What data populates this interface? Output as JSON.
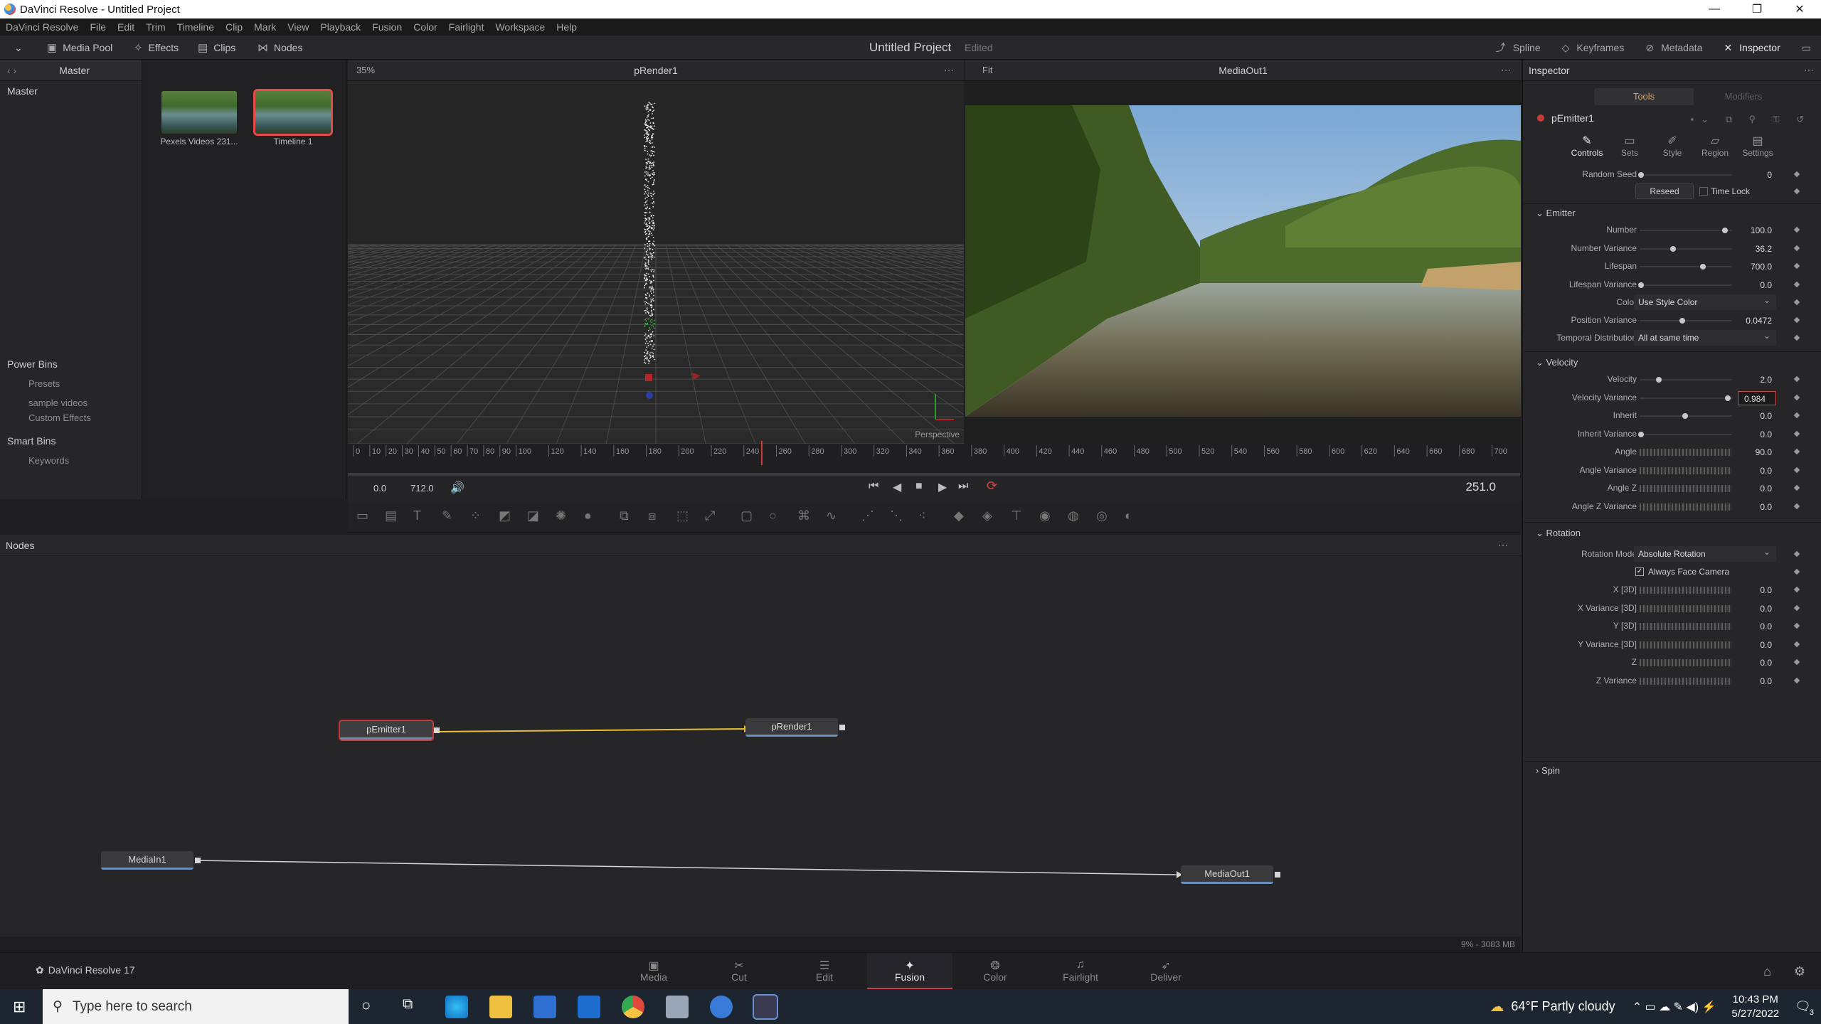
{
  "window": {
    "title": "DaVinci Resolve - Untitled Project",
    "minimize": "—",
    "maximize": "❐",
    "close": "✕"
  },
  "menu": [
    "DaVinci Resolve",
    "File",
    "Edit",
    "Trim",
    "Timeline",
    "Clip",
    "Mark",
    "View",
    "Playback",
    "Fusion",
    "Color",
    "Fairlight",
    "Workspace",
    "Help"
  ],
  "toolbar": {
    "media_pool": "Media Pool",
    "effects": "Effects",
    "clips": "Clips",
    "nodes": "Nodes",
    "project_title": "Untitled Project",
    "project_status": "Edited",
    "spline": "Spline",
    "keyframes": "Keyframes",
    "metadata": "Metadata",
    "inspector": "Inspector"
  },
  "bins": {
    "current": "Master",
    "master": "Master",
    "power_bins": "Power Bins",
    "power_items": [
      "Presets",
      "sample videos",
      "Custom Effects"
    ],
    "smart_bins": "Smart Bins",
    "smart_items": [
      "Keywords"
    ]
  },
  "media": [
    {
      "label": "Pexels Videos 231..."
    },
    {
      "label": "Timeline 1"
    }
  ],
  "viewer_left": {
    "zoom": "35%",
    "name": "pRender1",
    "mode": "Perspective"
  },
  "viewer_right": {
    "zoom": "Fit",
    "name": "MediaOut1"
  },
  "ruler": [
    "0",
    "10",
    "20",
    "30",
    "40",
    "50",
    "60",
    "70",
    "80",
    "90",
    "100",
    "120",
    "140",
    "160",
    "180",
    "200",
    "220",
    "240",
    "260",
    "280",
    "300",
    "320",
    "340",
    "360",
    "380",
    "400",
    "420",
    "440",
    "460",
    "480",
    "500",
    "520",
    "540",
    "560",
    "580",
    "600",
    "620",
    "640",
    "660",
    "680",
    "700"
  ],
  "transport": {
    "start": "0.0",
    "end": "712.0",
    "current": "251.0"
  },
  "nodes_panel": {
    "title": "Nodes",
    "nodes": [
      "pEmitter1",
      "pRender1",
      "MediaIn1",
      "MediaOut1"
    ]
  },
  "status": {
    "memory": "9% - 3083 MB"
  },
  "inspector": {
    "title": "Inspector",
    "tab_tools": "Tools",
    "tab_modifiers": "Modifiers",
    "node_name": "pEmitter1",
    "subtabs": [
      "Controls",
      "Sets",
      "Style",
      "Region",
      "Settings"
    ],
    "random_seed": {
      "label": "Random Seed",
      "value": "0"
    },
    "reseed": "Reseed",
    "time_lock": "Time Lock",
    "emitter_section": "Emitter",
    "emitter": [
      {
        "label": "Number",
        "value": "100.0",
        "level": 0.95
      },
      {
        "label": "Number Variance",
        "value": "36.2",
        "level": 0.36
      },
      {
        "label": "Lifespan",
        "value": "700.0",
        "level": 0.7
      },
      {
        "label": "Lifespan Variance",
        "value": "0.0",
        "level": 0.0
      }
    ],
    "color": {
      "label": "Color",
      "value": "Use Style Color"
    },
    "position_variance": {
      "label": "Position Variance",
      "value": "0.0472",
      "level": 0.47
    },
    "temporal": {
      "label": "Temporal Distribution",
      "value": "All at same time"
    },
    "velocity_section": "Velocity",
    "velocity": [
      {
        "label": "Velocity",
        "value": "2.0",
        "level": 0.2
      },
      {
        "label": "Velocity Variance",
        "value": "0.984",
        "level": 0.98
      },
      {
        "label": "Inherit",
        "value": "0.0",
        "level": 0.5
      },
      {
        "label": "Inherit Variance",
        "value": "0.0",
        "level": 0.0
      },
      {
        "label": "Angle",
        "value": "90.0"
      },
      {
        "label": "Angle Variance",
        "value": "0.0"
      },
      {
        "label": "Angle Z",
        "value": "0.0"
      },
      {
        "label": "Angle Z Variance",
        "value": "0.0"
      }
    ],
    "rotation_section": "Rotation",
    "rotation_mode": {
      "label": "Rotation Mode",
      "value": "Absolute Rotation"
    },
    "always_face": "Always Face Camera",
    "rotation": [
      {
        "label": "X [3D]",
        "value": "0.0"
      },
      {
        "label": "X Variance [3D]",
        "value": "0.0"
      },
      {
        "label": "Y [3D]",
        "value": "0.0"
      },
      {
        "label": "Y Variance [3D]",
        "value": "0.0"
      },
      {
        "label": "Z",
        "value": "0.0"
      },
      {
        "label": "Z Variance",
        "value": "0.0"
      }
    ],
    "spin_section": "Spin"
  },
  "pages": {
    "brand": "DaVinci Resolve 17",
    "tabs": [
      "Media",
      "Cut",
      "Edit",
      "Fusion",
      "Color",
      "Fairlight",
      "Deliver"
    ],
    "active": "Fusion"
  },
  "taskbar": {
    "search_placeholder": "Type here to search",
    "weather": "64°F  Partly cloudy",
    "time": "10:43 PM",
    "date": "5/27/2022",
    "notifications": "3"
  }
}
